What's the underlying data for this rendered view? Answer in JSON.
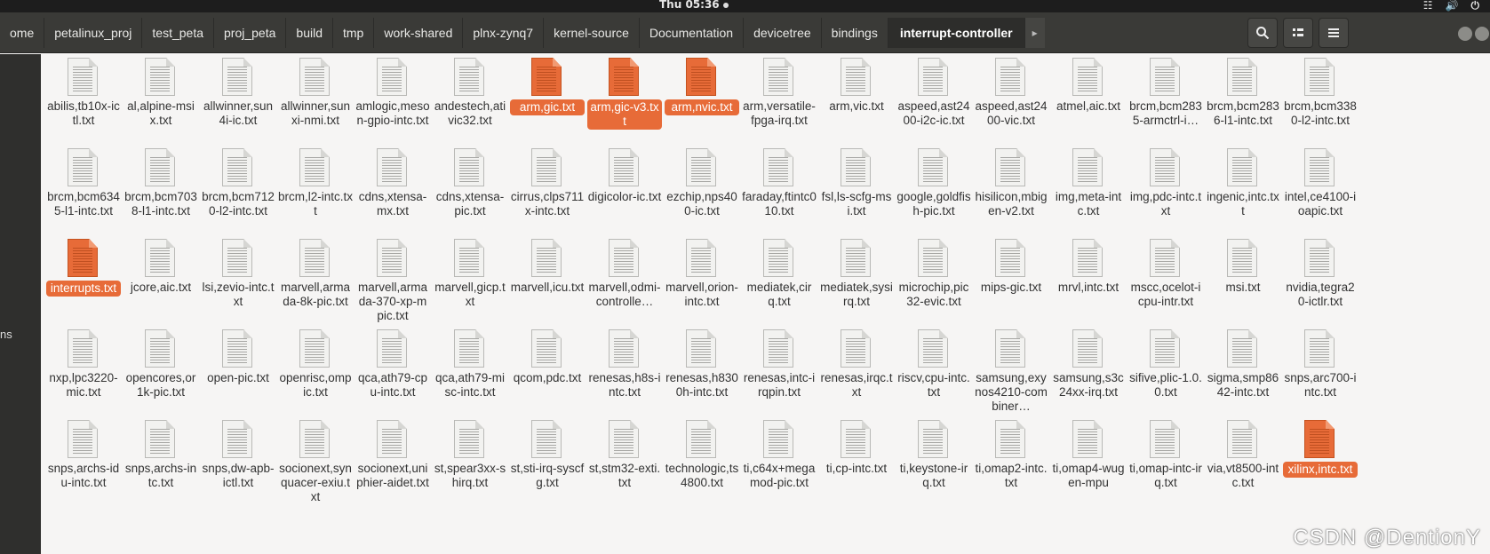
{
  "topbar": {
    "clock": "Thu 05:36"
  },
  "breadcrumbs": [
    "ome",
    "petalinux_proj",
    "test_peta",
    "proj_peta",
    "build",
    "tmp",
    "work-shared",
    "plnx-zynq7",
    "kernel-source",
    "Documentation",
    "devicetree",
    "bindings",
    "interrupt-controller"
  ],
  "active_crumb": "interrupt-controller",
  "sidebar": {
    "partial_label": "ns"
  },
  "icons": {
    "search": "search-icon",
    "view": "view-toggle-icon",
    "menu": "hamburger-menu-icon",
    "arrow": "chevron-right-icon"
  },
  "accent_color": "#e76b38",
  "watermark": "CSDN @DentionY",
  "rows": [
    [
      {
        "name": "abilis,tb10x-ictl.txt"
      },
      {
        "name": "al,alpine-msix.txt"
      },
      {
        "name": "allwinner,sun4i-ic.txt"
      },
      {
        "name": "allwinner,sunxi-nmi.txt"
      },
      {
        "name": "amlogic,meson-gpio-intc.txt"
      },
      {
        "name": "andestech,ativic32.txt"
      },
      {
        "name": "arm,gic.txt",
        "selected": true
      },
      {
        "name": "arm,gic-v3.txt",
        "selected": true
      },
      {
        "name": "arm,nvic.txt",
        "selected": true
      },
      {
        "name": "arm,versatile-fpga-irq.txt"
      },
      {
        "name": "arm,vic.txt"
      },
      {
        "name": "aspeed,ast2400-i2c-ic.txt"
      },
      {
        "name": "aspeed,ast2400-vic.txt"
      },
      {
        "name": "atmel,aic.txt"
      },
      {
        "name": "brcm,bcm2835-armctrl-i…"
      },
      {
        "name": "brcm,bcm2836-l1-intc.txt"
      },
      {
        "name": "brcm,bcm3380-l2-intc.txt"
      }
    ],
    [
      {
        "name": "brcm,bcm6345-l1-intc.txt"
      },
      {
        "name": "brcm,bcm7038-l1-intc.txt"
      },
      {
        "name": "brcm,bcm7120-l2-intc.txt"
      },
      {
        "name": "brcm,l2-intc.txt"
      },
      {
        "name": "cdns,xtensa-mx.txt"
      },
      {
        "name": "cdns,xtensa-pic.txt"
      },
      {
        "name": "cirrus,clps711x-intc.txt"
      },
      {
        "name": "digicolor-ic.txt"
      },
      {
        "name": "ezchip,nps400-ic.txt"
      },
      {
        "name": "faraday,ftintc010.txt"
      },
      {
        "name": "fsl,ls-scfg-msi.txt"
      },
      {
        "name": "google,goldfish-pic.txt"
      },
      {
        "name": "hisilicon,mbigen-v2.txt"
      },
      {
        "name": "img,meta-intc.txt"
      },
      {
        "name": "img,pdc-intc.txt"
      },
      {
        "name": "ingenic,intc.txt"
      },
      {
        "name": "intel,ce4100-ioapic.txt"
      }
    ],
    [
      {
        "name": "interrupts.txt",
        "selected": true
      },
      {
        "name": "jcore,aic.txt"
      },
      {
        "name": "lsi,zevio-intc.txt"
      },
      {
        "name": "marvell,armada-8k-pic.txt"
      },
      {
        "name": "marvell,armada-370-xp-mpic.txt"
      },
      {
        "name": "marvell,gicp.txt"
      },
      {
        "name": "marvell,icu.txt"
      },
      {
        "name": "marvell,odmi-controlle…"
      },
      {
        "name": "marvell,orion-intc.txt"
      },
      {
        "name": "mediatek,cirq.txt"
      },
      {
        "name": "mediatek,sysirq.txt"
      },
      {
        "name": "microchip,pic32-evic.txt"
      },
      {
        "name": "mips-gic.txt"
      },
      {
        "name": "mrvl,intc.txt"
      },
      {
        "name": "mscc,ocelot-icpu-intr.txt"
      },
      {
        "name": "msi.txt"
      },
      {
        "name": "nvidia,tegra20-ictlr.txt"
      }
    ],
    [
      {
        "name": "nxp,lpc3220-mic.txt"
      },
      {
        "name": "opencores,or1k-pic.txt"
      },
      {
        "name": "open-pic.txt"
      },
      {
        "name": "openrisc,ompic.txt"
      },
      {
        "name": "qca,ath79-cpu-intc.txt"
      },
      {
        "name": "qca,ath79-misc-intc.txt"
      },
      {
        "name": "qcom,pdc.txt"
      },
      {
        "name": "renesas,h8s-intc.txt"
      },
      {
        "name": "renesas,h8300h-intc.txt"
      },
      {
        "name": "renesas,intc-irqpin.txt"
      },
      {
        "name": "renesas,irqc.txt"
      },
      {
        "name": "riscv,cpu-intc.txt"
      },
      {
        "name": "samsung,exynos4210-combiner…"
      },
      {
        "name": "samsung,s3c24xx-irq.txt"
      },
      {
        "name": "sifive,plic-1.0.0.txt"
      },
      {
        "name": "sigma,smp8642-intc.txt"
      },
      {
        "name": "snps,arc700-intc.txt"
      }
    ],
    [
      {
        "name": "snps,archs-idu-intc.txt"
      },
      {
        "name": "snps,archs-intc.txt"
      },
      {
        "name": "snps,dw-apb-ictl.txt"
      },
      {
        "name": "socionext,synquacer-exiu.txt"
      },
      {
        "name": "socionext,uniphier-aidet.txt"
      },
      {
        "name": "st,spear3xx-shirq.txt"
      },
      {
        "name": "st,sti-irq-syscfg.txt"
      },
      {
        "name": "st,stm32-exti.txt"
      },
      {
        "name": "technologic,ts4800.txt"
      },
      {
        "name": "ti,c64x+megamod-pic.txt"
      },
      {
        "name": "ti,cp-intc.txt"
      },
      {
        "name": "ti,keystone-irq.txt"
      },
      {
        "name": "ti,omap2-intc.txt"
      },
      {
        "name": "ti,omap4-wugen-mpu"
      },
      {
        "name": "ti,omap-intc-irq.txt"
      },
      {
        "name": "via,vt8500-intc.txt"
      },
      {
        "name": "xilinx,intc.txt",
        "selected": true
      }
    ]
  ]
}
